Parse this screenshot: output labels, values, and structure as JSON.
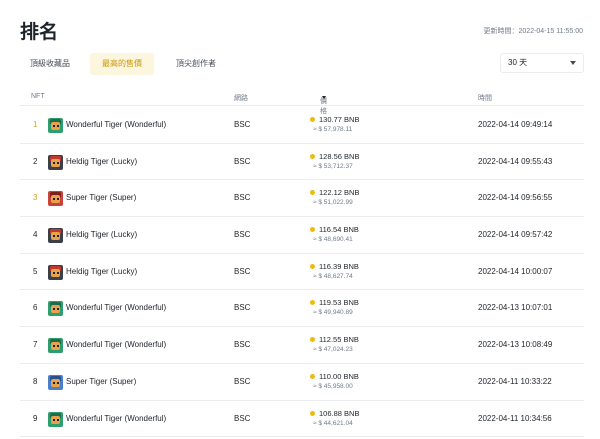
{
  "page": {
    "title": "排名",
    "updated_label": "更新時間：2022-04-15 11:55:00"
  },
  "tabs": [
    {
      "label": "頂級收藏品",
      "active": false
    },
    {
      "label": "最高的售價",
      "active": true
    },
    {
      "label": "頂尖創作者",
      "active": false
    }
  ],
  "period_select": {
    "value": "30 天"
  },
  "table": {
    "headers": {
      "nft": "NFT",
      "network": "網路",
      "price": "價格",
      "time": "時間"
    },
    "rows": [
      {
        "rank": "1",
        "name": "Wonderful Tiger (Wonderful)",
        "network": "BSC",
        "bnb": "130.77 BNB",
        "usd": "≈ $ 57,978.11",
        "time": "2022-04-14 09:49:14",
        "thumb": "green"
      },
      {
        "rank": "2",
        "name": "Heldig Tiger (Lucky)",
        "network": "BSC",
        "bnb": "128.56 BNB",
        "usd": "≈ $ 53,712.37",
        "time": "2022-04-14 09:55:43",
        "thumb": "dark"
      },
      {
        "rank": "3",
        "name": "Super Tiger (Super)",
        "network": "BSC",
        "bnb": "122.12 BNB",
        "usd": "≈ $ 51,022.99",
        "time": "2022-04-14 09:56:55",
        "thumb": "red"
      },
      {
        "rank": "4",
        "name": "Heldig Tiger (Lucky)",
        "network": "BSC",
        "bnb": "116.54 BNB",
        "usd": "≈ $ 48,690.41",
        "time": "2022-04-14 09:57:42",
        "thumb": "dark"
      },
      {
        "rank": "5",
        "name": "Heldig Tiger (Lucky)",
        "network": "BSC",
        "bnb": "116.39 BNB",
        "usd": "≈ $ 48,627.74",
        "time": "2022-04-14 10:00:07",
        "thumb": "dark"
      },
      {
        "rank": "6",
        "name": "Wonderful Tiger (Wonderful)",
        "network": "BSC",
        "bnb": "119.53 BNB",
        "usd": "≈ $ 49,940.89",
        "time": "2022-04-13 10:07:01",
        "thumb": "green"
      },
      {
        "rank": "7",
        "name": "Wonderful Tiger (Wonderful)",
        "network": "BSC",
        "bnb": "112.55 BNB",
        "usd": "≈ $ 47,024.23",
        "time": "2022-04-13 10:08:49",
        "thumb": "green"
      },
      {
        "rank": "8",
        "name": "Super Tiger (Super)",
        "network": "BSC",
        "bnb": "110.00 BNB",
        "usd": "≈ $ 45,958.00",
        "time": "2022-04-11 10:33:22",
        "thumb": "blue"
      },
      {
        "rank": "9",
        "name": "Wonderful Tiger (Wonderful)",
        "network": "BSC",
        "bnb": "106.88 BNB",
        "usd": "≈ $ 44,621.04",
        "time": "2022-04-11 10:34:56",
        "thumb": "green"
      }
    ]
  },
  "colors": {
    "accent": "#c99400",
    "gold_rank": "#d89f1e",
    "coin": "#f0b90b",
    "tab_active_bg": "#fdf6df"
  },
  "icons": {
    "sort": "sort-down-icon",
    "chevron": "chevron-down-icon",
    "coin": "bnb-coin-icon"
  }
}
